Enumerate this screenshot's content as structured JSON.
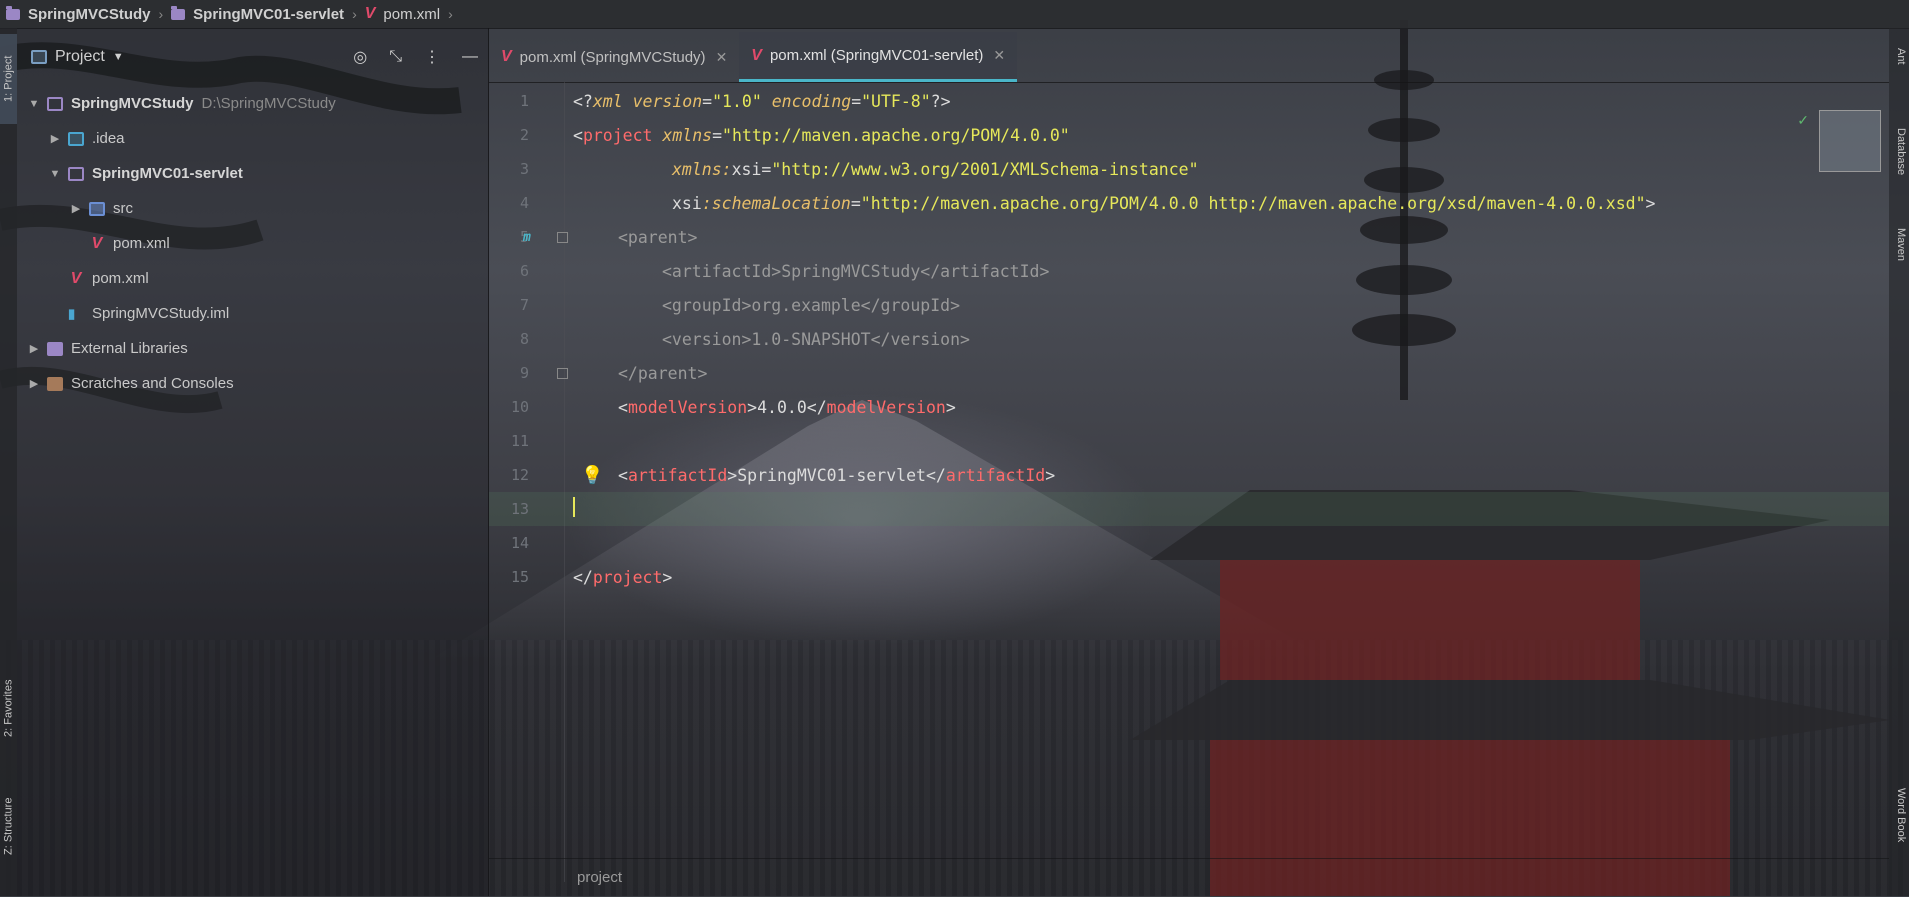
{
  "breadcrumb": {
    "items": [
      "SpringMVCStudy",
      "SpringMVC01-servlet",
      "pom.xml"
    ]
  },
  "left_strip": {
    "project_tab": "1: Project",
    "favorites_tab": "2: Favorites",
    "structure_tab": "Z: Structure"
  },
  "right_strip": {
    "ant": "Ant",
    "database": "Database",
    "maven": "Maven",
    "wordbook": "Word Book"
  },
  "project_panel": {
    "title": "Project",
    "tree": [
      {
        "label": "SpringMVCStudy",
        "path": "D:\\SpringMVCStudy"
      },
      {
        "label": ".idea"
      },
      {
        "label": "SpringMVC01-servlet"
      },
      {
        "label": "src"
      },
      {
        "label": "pom.xml"
      },
      {
        "label": "pom.xml"
      },
      {
        "label": "SpringMVCStudy.iml"
      },
      {
        "label": "External Libraries"
      },
      {
        "label": "Scratches and Consoles"
      }
    ]
  },
  "editor": {
    "tabs": [
      {
        "label": "pom.xml (SpringMVCStudy)",
        "active": false
      },
      {
        "label": "pom.xml (SpringMVC01-servlet)",
        "active": true
      }
    ],
    "line_numbers": [
      "1",
      "2",
      "3",
      "4",
      "5",
      "6",
      "7",
      "8",
      "9",
      "10",
      "11",
      "12",
      "13",
      "14",
      "15"
    ],
    "code": {
      "l1_a": "<?",
      "l1_b": "xml",
      "l1_c": " version",
      "l1_d": "=",
      "l1_e": "\"1.0\"",
      "l1_f": " encoding",
      "l1_g": "=",
      "l1_h": "\"UTF-8\"",
      "l1_i": "?>",
      "l2_a": "<",
      "l2_b": "project",
      "l2_c": " xmlns",
      "l2_d": "=",
      "l2_e": "\"http://maven.apache.org/POM/4.0.0\"",
      "l3_a": "xmlns:",
      "l3_b": "xsi",
      "l3_c": "=",
      "l3_d": "\"http://www.w3.org/2001/XMLSchema-instance\"",
      "l4_a": "xsi",
      "l4_b": ":schemaLocation",
      "l4_c": "=",
      "l4_d": "\"http://maven.apache.org/POM/4.0.0 http://maven.apache.org/xsd/maven-4.0.0.xsd\"",
      "l4_e": ">",
      "l5": "<parent>",
      "l6": "<artifactId>SpringMVCStudy</artifactId>",
      "l7": "<groupId>org.example</groupId>",
      "l8": "<version>1.0-SNAPSHOT</version>",
      "l9": "</parent>",
      "l10_a": "<",
      "l10_b": "modelVersion",
      "l10_c": ">",
      "l10_d": "4.0.0",
      "l10_e": "</",
      "l10_f": "modelVersion",
      "l10_g": ">",
      "l12_a": "<",
      "l12_b": "artifactId",
      "l12_c": ">",
      "l12_d": "SpringMVC01-servlet",
      "l12_e": "</",
      "l12_f": "artifactId",
      "l12_g": ">",
      "l15_a": "</",
      "l15_b": "project",
      "l15_c": ">"
    },
    "gutter_marker": "m",
    "status_path": "project"
  },
  "colors": {
    "accent_tab": "#4ab6c9",
    "tag_red": "#ff6b6b",
    "string_yellow": "#e6e85a",
    "attr_orange": "#e8bf6a",
    "maven_red": "#e04a6a"
  }
}
